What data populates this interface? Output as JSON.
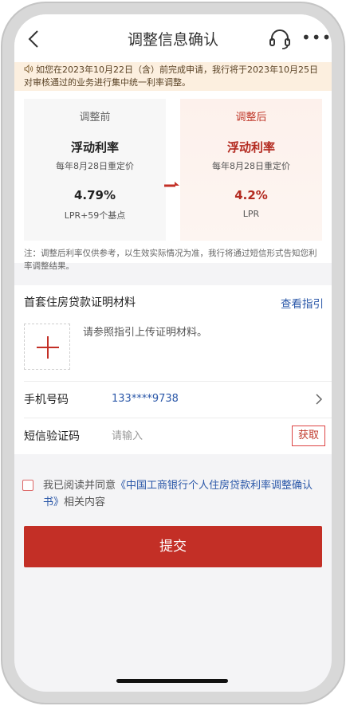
{
  "header": {
    "title": "调整信息确认"
  },
  "notice": {
    "text": "如您在2023年10月22日（含）前完成申请，我行将于2023年10月25日对审核通过的业务进行集中统一利率调整。"
  },
  "compare": {
    "before": {
      "label": "调整前",
      "type": "浮动利率",
      "reset": "每年8月28日重定价",
      "rate": "4.79%",
      "basis": "LPR+59个基点"
    },
    "after": {
      "label": "调整后",
      "type": "浮动利率",
      "reset": "每年8月28日重定价",
      "rate": "4.2%",
      "basis": "LPR"
    },
    "footnote": "注：调整后利率仅供参考，以生效实际情况为准，我行将通过短信形式告知您利率调整结果。"
  },
  "materials": {
    "title": "首套住房贷款证明材料",
    "guide_link": "查看指引",
    "upload_hint": "请参照指引上传证明材料。"
  },
  "phone": {
    "label": "手机号码",
    "value": "133****9738"
  },
  "sms": {
    "label": "短信验证码",
    "placeholder": "请输入",
    "get_code": "获取"
  },
  "agreement": {
    "prefix": "我已阅读并同意",
    "link": "《中国工商银行个人住房贷款利率调整确认书》",
    "suffix": "相关内容"
  },
  "submit": {
    "label": "提交"
  },
  "colors": {
    "accent_red": "#c32f26",
    "link_blue": "#2a57a8",
    "notice_bg": "#fcefdf"
  }
}
